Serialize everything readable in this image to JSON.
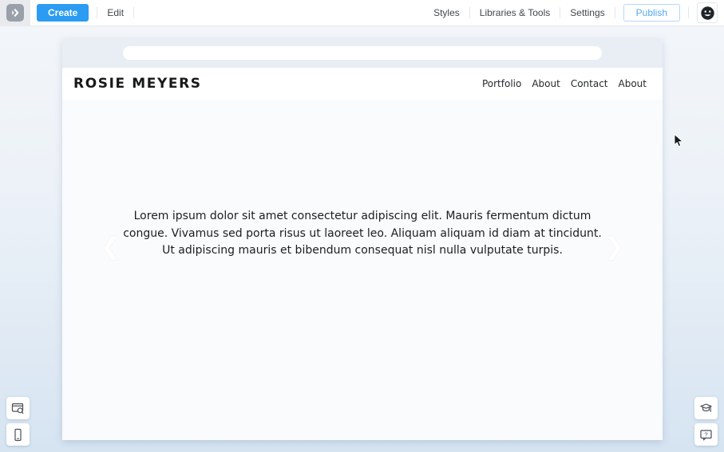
{
  "toolbar": {
    "create_label": "Create",
    "edit_label": "Edit",
    "styles_label": "Styles",
    "libraries_label": "Libraries & Tools",
    "settings_label": "Settings",
    "publish_label": "Publish",
    "logo_icon": "chevron-badge",
    "avatar_icon": "smiley-face"
  },
  "site": {
    "title": "ROSIE MEYERS",
    "nav": [
      {
        "label": "Portfolio"
      },
      {
        "label": "About"
      },
      {
        "label": "Contact"
      },
      {
        "label": "About"
      }
    ],
    "paragraph": "Lorem ipsum dolor sit amet consectetur adipiscing elit. Mauris fermentum dictum congue. Vivamus sed porta risus ut laoreet leo. Aliquam aliquam id diam at tincidunt. Ut adipiscing mauris et bibendum consequat nisl nulla vulputate turpis.",
    "carousel": {
      "prev": "❮",
      "next": "❯"
    }
  },
  "floating_buttons": {
    "left": [
      {
        "icon": "site-preview-search-icon"
      },
      {
        "icon": "mobile-preview-icon"
      }
    ],
    "right": [
      {
        "icon": "learning-cap-icon"
      },
      {
        "icon": "help-chat-icon"
      }
    ]
  },
  "colors": {
    "accent_blue": "#2b9cf2",
    "publish_text": "#55a9f2",
    "publish_border": "#b6d9f8",
    "toolbar_bg": "#ffffff",
    "workspace_bg_top": "#f3f6fa",
    "workspace_bg_bottom": "#d6e4f2",
    "chrome_bar": "#e9edf4",
    "site_body_bg": "#fafbfd"
  }
}
